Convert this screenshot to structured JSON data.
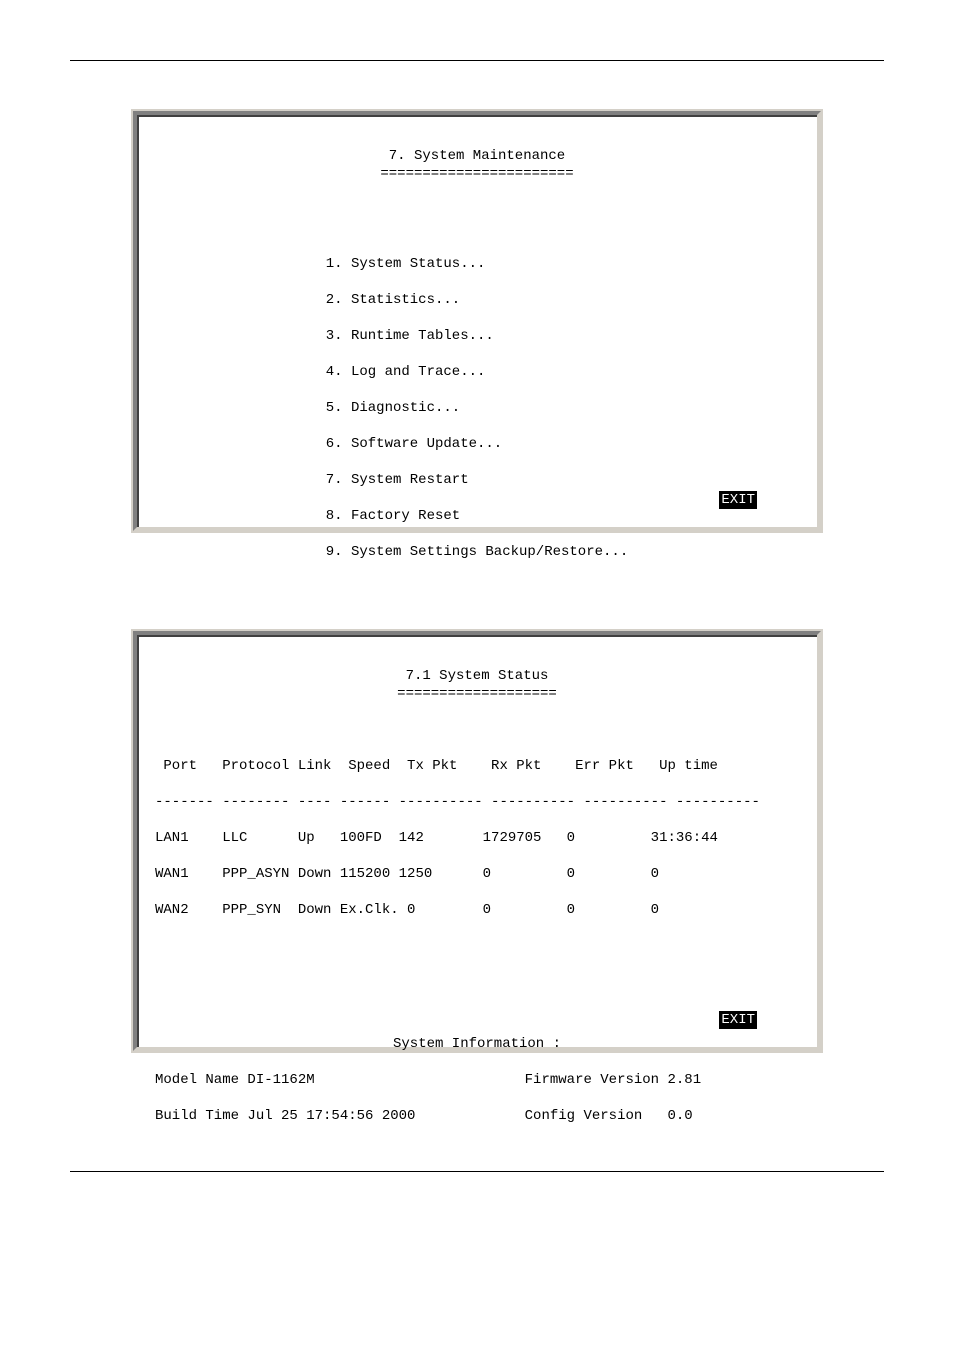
{
  "screen1": {
    "title": "7. System Maintenance",
    "underline": "=======================",
    "menu": [
      "1. System Status...",
      "2. Statistics...",
      "3. Runtime Tables...",
      "4. Log and Trace...",
      "5. Diagnostic...",
      "6. Software Update...",
      "7. System Restart",
      "8. Factory Reset",
      "9. System Settings Backup/Restore..."
    ],
    "exit": "EXIT"
  },
  "screen2": {
    "title": "7.1 System Status",
    "underline": "===================",
    "headers": " Port   Protocol Link  Speed  Tx Pkt    Rx Pkt    Err Pkt   Up time",
    "divider": "------- -------- ---- ------ ---------- ---------- ---------- ----------",
    "rows": [
      {
        "port": "LAN1",
        "protocol": "LLC",
        "link": "Up",
        "speed": "100FD",
        "tx": "142",
        "rx": "1729705",
        "err": "0",
        "up": "31:36:44"
      },
      {
        "port": "WAN1",
        "protocol": "PPP_ASYN",
        "link": "Down",
        "speed": "115200",
        "tx": "1250",
        "rx": "0",
        "err": "0",
        "up": "0"
      },
      {
        "port": "WAN2",
        "protocol": "PPP_SYN",
        "link": "Down",
        "speed": "Ex.Clk.",
        "tx": "0",
        "rx": "0",
        "err": "0",
        "up": "0"
      }
    ],
    "row_lines": [
      "LAN1    LLC      Up   100FD  142       1729705   0         31:36:44",
      "WAN1    PPP_ASYN Down 115200 1250      0         0         0",
      "WAN2    PPP_SYN  Down Ex.Clk. 0        0         0         0"
    ],
    "sysinfo_title": "System Information :",
    "model_label": "Model Name",
    "model_value": "DI-1162M",
    "fw_label": "Firmware Version",
    "fw_value": "2.81",
    "build_label": "Build Time",
    "build_value": "Jul 25 17:54:56 2000",
    "cfg_label": "Config Version",
    "cfg_value": "0.0",
    "info_line1": "Model Name DI-1162M                         Firmware Version 2.81",
    "info_line2": "Build Time Jul 25 17:54:56 2000             Config Version   0.0",
    "exit": "EXIT"
  }
}
